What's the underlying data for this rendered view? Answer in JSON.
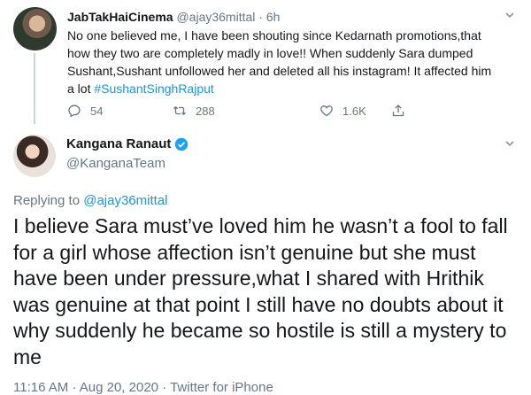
{
  "tweet1": {
    "display_name": "JabTakHaiCinema",
    "handle": "@ajay36mittal",
    "separator": "·",
    "time": "6h",
    "text": "No one believed me, I have been shouting since Kedarnath promotions,that how they two are completely madly in love!! When suddenly Sara dumped Sushant,Sushant unfollowed her and deleted all his instagram! It affected him a lot",
    "hashtag": "#SushantSinghRajput",
    "reply_count": "54",
    "retweet_count": "288",
    "like_count": "1.6K"
  },
  "tweet2": {
    "display_name": "Kangana Ranaut",
    "handle": "@KanganaTeam",
    "replying_prefix": "Replying to",
    "replying_to": "@ajay36mittal",
    "text": "I believe Sara must’ve loved him he wasn’t a fool to fall for a girl whose affection isn’t genuine but she must have been under pressure,what I shared with Hrithik was genuine at that point I still have no doubts about it why suddenly he became so hostile is still a mystery to me",
    "meta": "11:16 AM · Aug 20, 2020 · Twitter for iPhone"
  },
  "icons": [
    "chevron-down-icon",
    "reply-icon",
    "retweet-icon",
    "like-icon",
    "share-icon",
    "verified-badge-icon"
  ],
  "colors": {
    "link": "#1b95e0",
    "muted": "#657786",
    "text": "#14171a"
  }
}
